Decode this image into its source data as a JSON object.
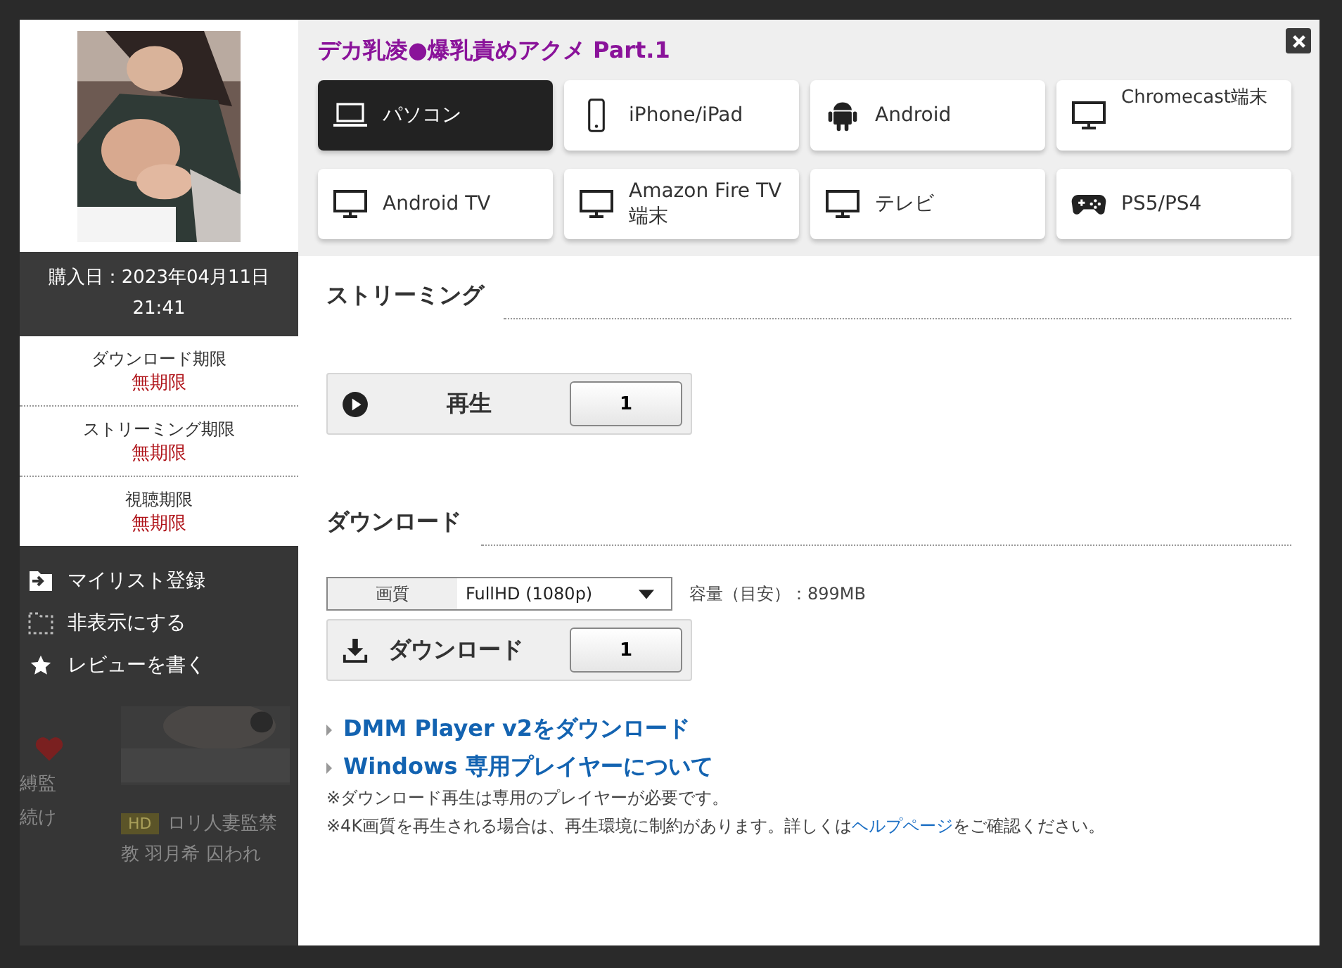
{
  "product": {
    "title": "デカ乳凌●爆乳責めアクメ Part.1",
    "purchase_date": "購入日：2023年04月11日 21:41",
    "limits": [
      {
        "label": "ダウンロード期限",
        "value": "無期限"
      },
      {
        "label": "ストリーミング期限",
        "value": "無期限"
      },
      {
        "label": "視聴期限",
        "value": "無期限"
      }
    ],
    "actions": [
      {
        "kind": "mylist",
        "label": "マイリスト登録"
      },
      {
        "kind": "hide",
        "label": "非表示にする"
      },
      {
        "kind": "review",
        "label": "レビューを書く"
      }
    ]
  },
  "background": {
    "left_texts": [
      "縛監",
      "続け"
    ],
    "badge": "HD",
    "title_lines": [
      "ロリ人妻監禁",
      "教 羽月希 囚われ"
    ]
  },
  "devices": [
    {
      "kind": "pc",
      "label": "パソコン",
      "selected": true
    },
    {
      "kind": "phone",
      "label": "iPhone/iPad",
      "selected": false
    },
    {
      "kind": "android",
      "label": "Android",
      "selected": false
    },
    {
      "kind": "tv",
      "label": "Chromecast端末",
      "selected": false
    },
    {
      "kind": "tv",
      "label": "Android TV",
      "selected": false
    },
    {
      "kind": "tv",
      "label": "Amazon Fire TV 端末",
      "selected": false
    },
    {
      "kind": "tv",
      "label": "テレビ",
      "selected": false
    },
    {
      "kind": "game",
      "label": "PS5/PS4",
      "selected": false
    }
  ],
  "streaming": {
    "heading": "ストリーミング",
    "button": "再生",
    "count": "1"
  },
  "download": {
    "heading": "ダウンロード",
    "quality_label": "画質",
    "quality": "FullHD (1080p)",
    "size": "容量（目安）：899MB",
    "button": "ダウンロード",
    "count": "1"
  },
  "links": [
    "DMM Player v2をダウンロード",
    "Windows 専用プレイヤーについて"
  ],
  "notes": [
    {
      "text": "※ダウンロード再生は専用のプレイヤーが必要です。"
    },
    {
      "text": "※4K画質を再生される場合は、再生環境に制約があります。詳しくは",
      "link": "ヘルプページ",
      "after": "をご確認ください。"
    }
  ]
}
